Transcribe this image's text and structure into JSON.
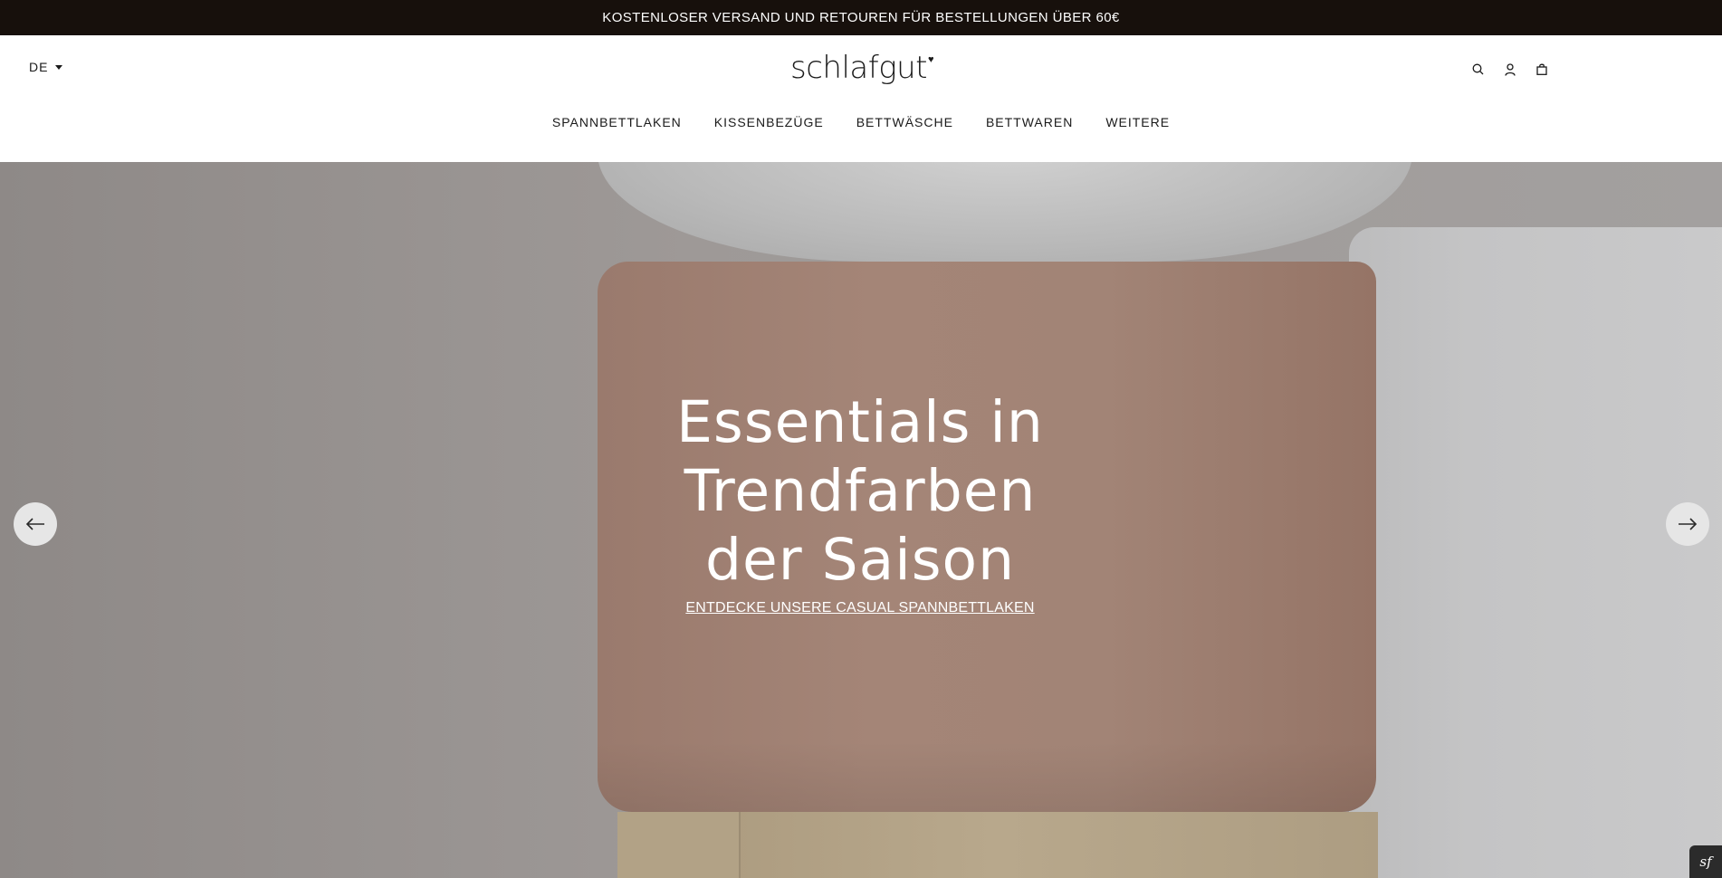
{
  "announcement": {
    "text": "KOSTENLOSER VERSAND UND RETOUREN FÜR BESTELLUNGEN ÜBER 60€"
  },
  "header": {
    "language": "DE",
    "logo": "schlafgut",
    "logo_mark": "♥",
    "icons": [
      "search-icon",
      "account-icon",
      "cart-icon"
    ]
  },
  "nav": {
    "items": [
      {
        "label": "SPANNBETTLAKEN"
      },
      {
        "label": "KISSENBEZÜGE"
      },
      {
        "label": "BETTWÄSCHE"
      },
      {
        "label": "BETTWAREN"
      },
      {
        "label": "WEITERE"
      }
    ]
  },
  "hero": {
    "title_line1": "Essentials in",
    "title_line2": "Trendfarben",
    "title_line3": "der Saison",
    "cta": "ENTDECKE UNSERE CASUAL SPANNBETTLAKEN",
    "prev_icon": "arrow-left-icon",
    "next_icon": "arrow-right-icon"
  },
  "badge": {
    "text": "sf"
  },
  "colors": {
    "announcement_bg": "#17100c",
    "text": "#1a1a1a",
    "hero_mattress": "#a48577",
    "hero_wall": "#9a9593",
    "hero_sheet": "#c4c4c5"
  }
}
